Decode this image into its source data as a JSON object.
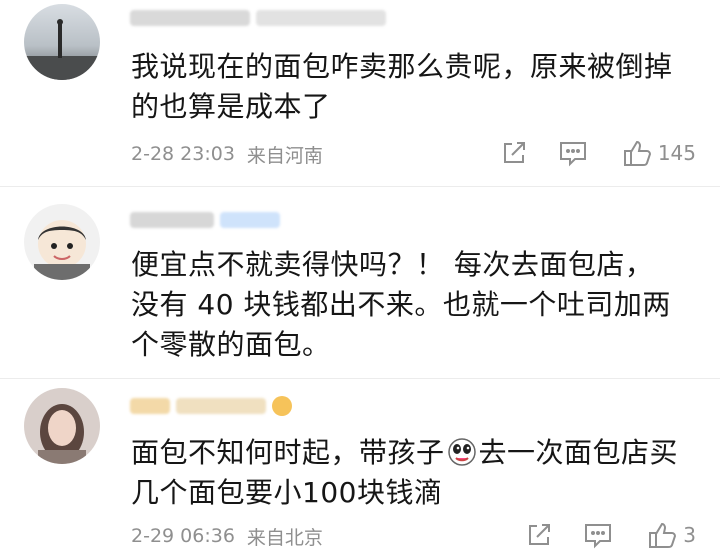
{
  "comments": [
    {
      "text": "我说现在的面包咋卖那么贵呢，原来被倒掉的也算是成本了",
      "time": "2-28 23:03",
      "location": "来自河南",
      "likes": "145",
      "icons": {
        "share": "share-icon",
        "comment": "comment-icon",
        "like": "thumbs-up-icon"
      }
    },
    {
      "text": "便宜点不就卖得快吗？！ 每次去面包店，没有 40 块钱都出不来。也就一个吐司加两个零散的面包。"
    },
    {
      "text_before": "面包不知何时起，带孩子",
      "emoji": "face-emoji",
      "text_after": "去一次面包店买几个面包要小100块钱滴",
      "time": "2-29 06:36",
      "location": "来自北京",
      "likes": "3",
      "icons": {
        "share": "share-icon",
        "comment": "comment-icon",
        "like": "thumbs-up-icon"
      }
    }
  ],
  "colors": {
    "meta": "#8f8f8f",
    "badge": "#cfe3fb",
    "name_blur": "#d8d8d8",
    "name_gold": "#f3d9a8"
  }
}
